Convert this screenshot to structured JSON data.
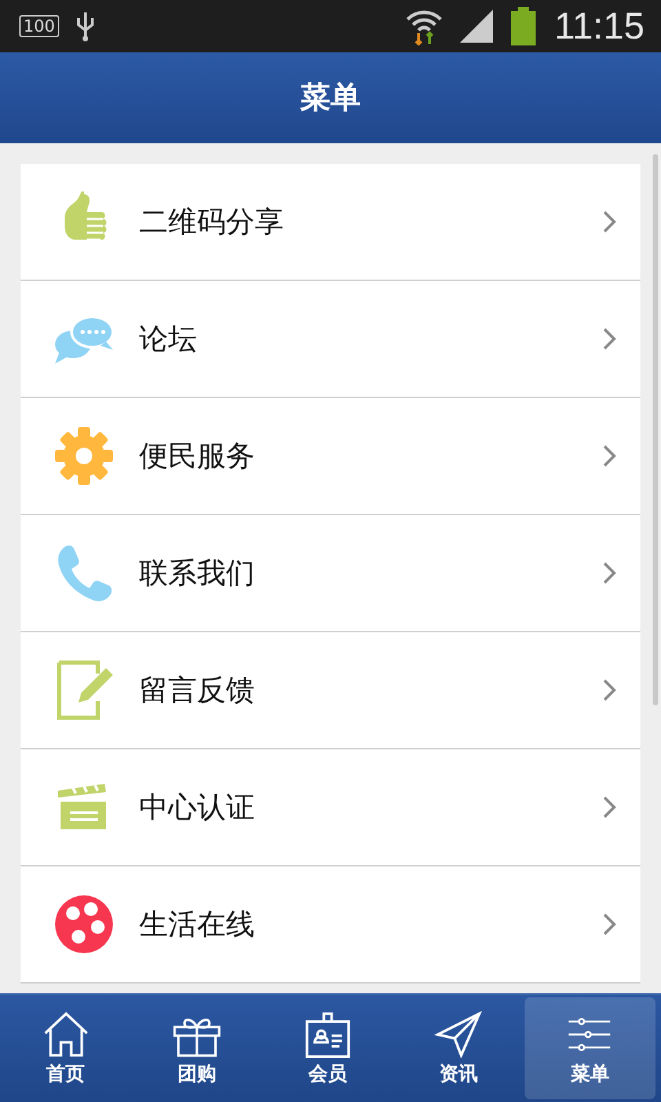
{
  "status_bar": {
    "badge": "100",
    "time": "11:15"
  },
  "header": {
    "title": "菜单"
  },
  "menu": [
    {
      "label": "二维码分享",
      "kind": "thumb"
    },
    {
      "label": "论坛",
      "kind": "chat"
    },
    {
      "label": "便民服务",
      "kind": "gear"
    },
    {
      "label": "联系我们",
      "kind": "phone"
    },
    {
      "label": "留言反馈",
      "kind": "edit"
    },
    {
      "label": "中心认证",
      "kind": "clapper"
    },
    {
      "label": "生活在线",
      "kind": "film"
    }
  ],
  "tabs": [
    {
      "label": "首页",
      "kind": "home",
      "selected": false
    },
    {
      "label": "团购",
      "kind": "gift",
      "selected": false
    },
    {
      "label": "会员",
      "kind": "badge",
      "selected": false
    },
    {
      "label": "资讯",
      "kind": "plane",
      "selected": false
    },
    {
      "label": "菜单",
      "kind": "sliders",
      "selected": true
    }
  ]
}
